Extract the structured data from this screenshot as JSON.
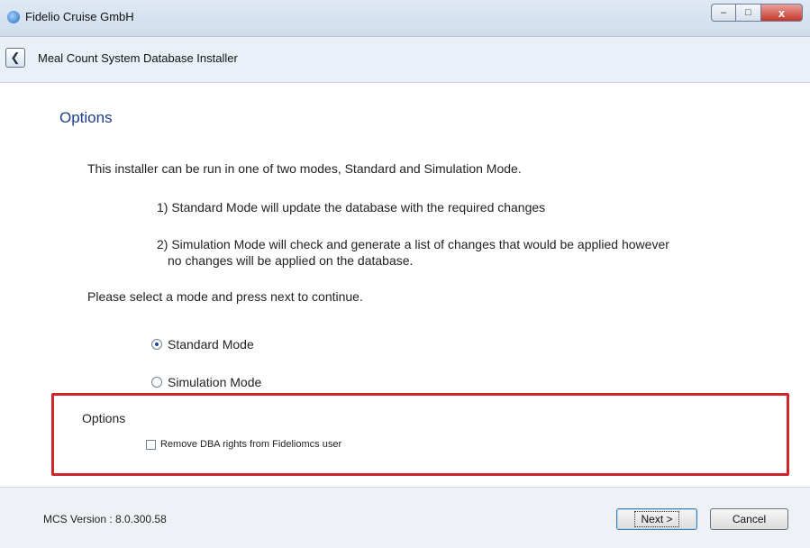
{
  "window": {
    "title": "Fidelio Cruise GmbH",
    "controls": {
      "minimize": "–",
      "maximize": "□",
      "close": "x"
    },
    "icons": {
      "app": "app-swirl-icon"
    }
  },
  "header": {
    "back_glyph": "❮",
    "title": "Meal Count System Database Installer"
  },
  "main": {
    "heading": "Options",
    "intro": "This installer can be run in one of two modes, Standard and Simulation Mode.",
    "item1": "1) Standard Mode will update the database with the required changes",
    "item2_line1": "2) Simulation Mode will check and generate a list of changes that would be  applied however",
    "item2_line2": "no changes will be applied on the database.",
    "prompt": "Please select a mode and press next to continue.",
    "modes": [
      {
        "label": "Standard Mode",
        "selected": true
      },
      {
        "label": "Simulation Mode",
        "selected": false
      }
    ],
    "options_label": "Options",
    "checkbox_label": "Remove DBA rights from Fideliomcs user",
    "checkbox_checked": false,
    "highlight_color": "#d0232a"
  },
  "footer": {
    "version": "MCS Version : 8.0.300.58",
    "next_label": "Next >",
    "cancel_label": "Cancel"
  }
}
